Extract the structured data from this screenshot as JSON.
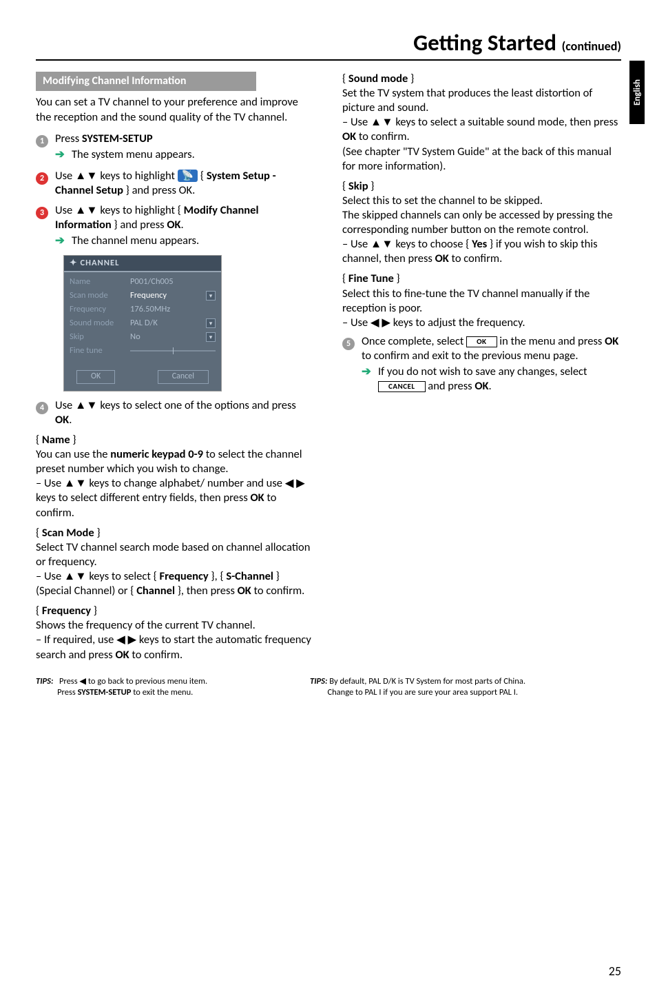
{
  "page_number": "25",
  "side_tab": "English",
  "title": "Getting Started",
  "title_suffix": "(continued)",
  "left": {
    "section_bar": "Modifying Channel Information",
    "intro": "You can set a TV channel to your preference and improve the reception and the sound quality of the TV channel.",
    "s1_a": "Press ",
    "s1_b": "SYSTEM-SETUP",
    "s1_arrow": "The system menu appears.",
    "s2_a": "Use ▲▼ keys to highlight ",
    "s2_pill": "📡",
    "s2_b": " { ",
    "s2_c": "System Setup - Channel Setup",
    "s2_d": " } and press OK.",
    "s3_a": "Use ▲▼ keys to highlight { ",
    "s3_b": "Modify Channel Information",
    "s3_c": " } and press ",
    "s3_d": "OK",
    "s3_e": ".",
    "s3_arrow": "The channel menu appears.",
    "s4": "Use ▲▼ keys to select one of the options and press ",
    "s4_ok": "OK",
    "s4_dot": ".",
    "name_t": "Name",
    "name_p1a": "You can use the ",
    "name_p1b": "numeric keypad 0-9",
    "name_p1c": " to select the channel preset number which you wish to change.",
    "name_p2a": "– Use ▲▼ keys to change alphabet/ number and use ◀ ▶ keys to select different entry fields, then press ",
    "name_p2b": "OK",
    "name_p2c": " to confirm.",
    "scan_t": "Scan Mode",
    "scan_p1": "Select TV channel search mode based on channel allocation or frequency.",
    "scan_p2a": "– Use ▲▼ keys to select { ",
    "scan_p2b": "Frequency",
    "scan_p2mid": " }, { ",
    "scan_p2c": "S-Channel",
    "scan_p2d": " } (Special Channel) or { ",
    "scan_p2e": "Channel",
    "scan_p2f": " }, then press ",
    "scan_p2g": "OK",
    "scan_p2h": " to confirm.",
    "freq_t": "Frequency",
    "freq_p1": "Shows the frequency of the current TV channel.",
    "freq_p2a": "– If required, use ◀ ▶ keys to start the automatic frequency search and press ",
    "freq_p2b": "OK",
    "freq_p2c": " to confirm."
  },
  "right": {
    "sound_t": "Sound mode",
    "sound_p1": "Set the TV system that produces the least distortion of picture and sound.",
    "sound_p2a": "– Use ▲▼ keys to select a suitable sound mode, then press ",
    "sound_p2b": "OK",
    "sound_p2c": " to confirm.",
    "sound_p3": "(See chapter \"TV System Guide\" at the back of this manual for more information).",
    "skip_t": "Skip",
    "skip_p1": "Select this to set the channel to be skipped.",
    "skip_p2": "The skipped channels can only be accessed by pressing the corresponding number button on the remote control.",
    "skip_p3a": "– Use ▲▼ keys to choose { ",
    "skip_p3b": "Yes",
    "skip_p3c": " } if you wish to skip this channel, then press ",
    "skip_p3d": "OK",
    "skip_p3e": " to confirm.",
    "fine_t": "Fine Tune",
    "fine_p1": "Select this to fine-tune the TV channel manually if the reception is poor.",
    "fine_p2": "– Use ◀ ▶ keys to adjust the frequency.",
    "s5_a": "Once complete, select ",
    "s5_ok_box": "OK",
    "s5_b": " in the menu and press ",
    "s5_c": "OK",
    "s5_d": " to confirm and exit to the previous menu page.",
    "s5_arrow_a": "If you do not wish to save any changes, select ",
    "s5_cancel_box": "CANCEL",
    "s5_arrow_b": " and press ",
    "s5_arrow_c": "OK",
    "s5_arrow_d": "."
  },
  "menu": {
    "header": "CHANNEL",
    "rows": {
      "name_l": "Name",
      "name_v": "P001/Ch005",
      "scan_l": "Scan mode",
      "scan_v": "Frequency",
      "freq_l": "Frequency",
      "freq_v": "176.50MHz",
      "sound_l": "Sound mode",
      "sound_v": "PAL D/K",
      "skip_l": "Skip",
      "skip_v": "No",
      "fine_l": "Fine tune"
    },
    "ok": "OK",
    "cancel": "Cancel"
  },
  "tips_left": {
    "label": "TIPS:",
    "l1": "Press ◀ to go back to previous menu item.",
    "l2a": "Press ",
    "l2b": "SYSTEM-SETUP",
    "l2c": " to exit the menu."
  },
  "tips_right": {
    "label": "TIPS:",
    "l1": "By default, PAL D/K is TV System for most parts of China.",
    "l2": "Change to PAL I if you are sure your area support PAL I."
  }
}
